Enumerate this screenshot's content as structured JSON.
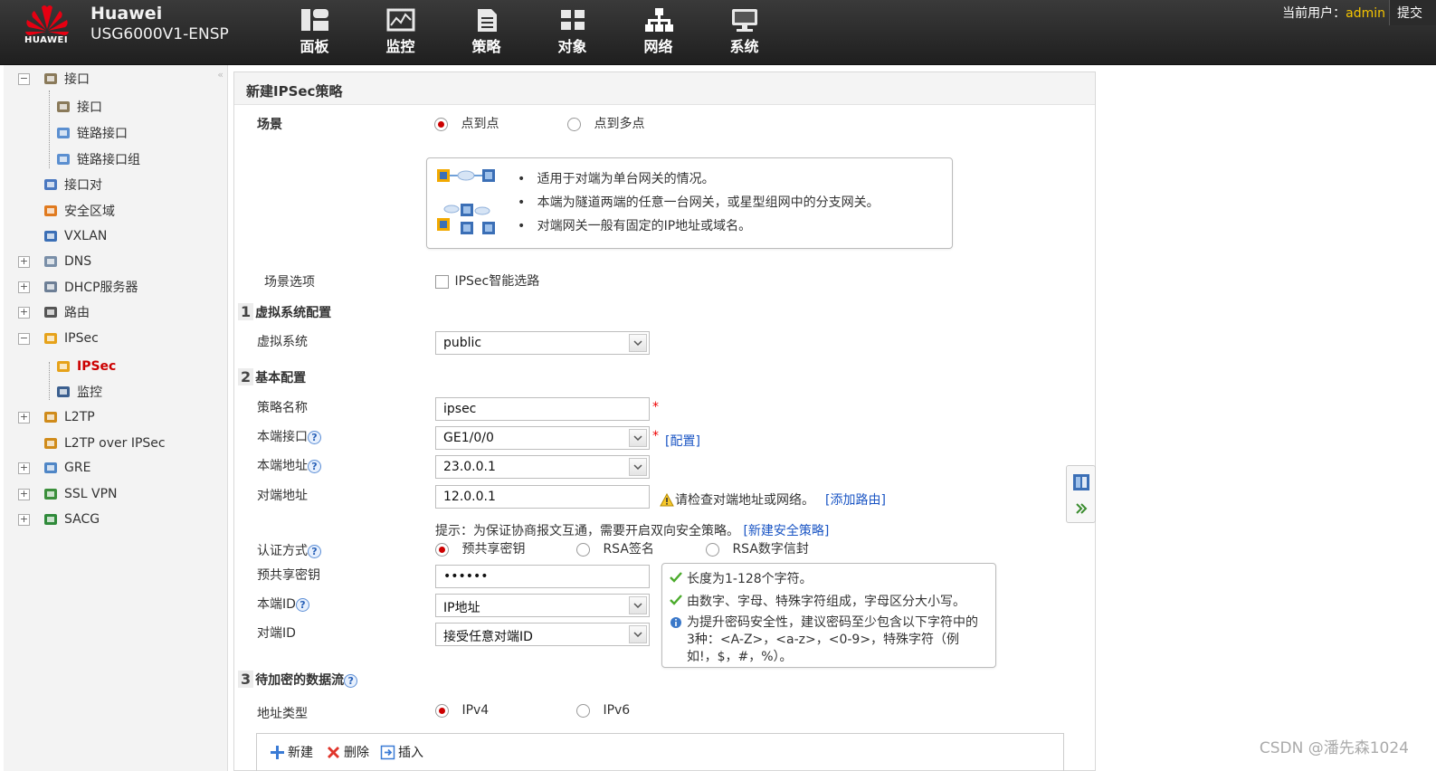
{
  "header": {
    "logo_text": "HUAWEI",
    "brand": "Huawei",
    "model": "USG6000V1-ENSP",
    "nav": [
      {
        "label": "面板",
        "icon": "dashboard-icon"
      },
      {
        "label": "监控",
        "icon": "monitor-icon"
      },
      {
        "label": "策略",
        "icon": "policy-icon"
      },
      {
        "label": "对象",
        "icon": "object-icon"
      },
      {
        "label": "网络",
        "icon": "network-icon"
      },
      {
        "label": "系统",
        "icon": "system-icon"
      }
    ],
    "user_label": "当前用户：",
    "user_name": "admin",
    "commit": "提交"
  },
  "sidebar": {
    "items": [
      {
        "label": "接口",
        "expander": "−",
        "icon": "interface-icon"
      },
      {
        "label": "接口",
        "icon": "interface-icon"
      },
      {
        "label": "链路接口",
        "icon": "link-interface-icon"
      },
      {
        "label": "链路接口组",
        "icon": "link-interface-group-icon"
      },
      {
        "label": "接口对",
        "icon": "interface-pair-icon"
      },
      {
        "label": "安全区域",
        "icon": "security-zone-icon"
      },
      {
        "label": "VXLAN",
        "icon": "vxlan-icon"
      },
      {
        "label": "DNS",
        "expander": "+",
        "icon": "dns-icon"
      },
      {
        "label": "DHCP服务器",
        "expander": "+",
        "icon": "dhcp-icon"
      },
      {
        "label": "路由",
        "expander": "+",
        "icon": "route-icon"
      },
      {
        "label": "IPSec",
        "expander": "−",
        "icon": "ipsec-icon"
      },
      {
        "label": "IPSec",
        "icon": "ipsec-icon",
        "active": true
      },
      {
        "label": "监控",
        "icon": "monitor-icon"
      },
      {
        "label": "L2TP",
        "expander": "+",
        "icon": "l2tp-icon"
      },
      {
        "label": "L2TP over IPSec",
        "icon": "l2tp-ipsec-icon"
      },
      {
        "label": "GRE",
        "expander": "+",
        "icon": "gre-icon"
      },
      {
        "label": "SSL VPN",
        "expander": "+",
        "icon": "ssl-vpn-icon"
      },
      {
        "label": "SACG",
        "expander": "+",
        "icon": "sacg-icon"
      }
    ]
  },
  "panel": {
    "title": "新建IPSec策略",
    "scene_label": "场景",
    "scene_options": [
      "点到点",
      "点到多点"
    ],
    "scene_selected": "点到点",
    "scene_info": [
      "适用于对端为单台网关的情况。",
      "本端为隧道两端的任意一台网关，或星型组网中的分支网关。",
      "对端网关一般有固定的IP地址或域名。"
    ],
    "scene_option_label": "场景选项",
    "smart_route_label": "IPSec智能选路",
    "section1": {
      "num": "1",
      "title": "虚拟系统配置"
    },
    "vsys_label": "虚拟系统",
    "vsys_value": "public",
    "section2": {
      "num": "2",
      "title": "基本配置"
    },
    "policy_name_label": "策略名称",
    "policy_name_value": "ipsec",
    "local_if_label": "本端接口",
    "local_if_value": "GE1/0/0",
    "config_link": "[配置]",
    "local_addr_label": "本端地址",
    "local_addr_value": "23.0.0.1",
    "peer_addr_label": "对端地址",
    "peer_addr_value": "12.0.0.1",
    "peer_warning": "请检查对端地址或网络。",
    "add_route_link": "[添加路由]",
    "hint_text": "提示：为保证协商报文互通，需要开启双向安全策略。",
    "new_policy_link": "[新建安全策略]",
    "auth_label": "认证方式",
    "auth_options": [
      "预共享密钥",
      "RSA签名",
      "RSA数字信封"
    ],
    "auth_selected": "预共享密钥",
    "psk_label": "预共享密钥",
    "psk_value": "••••••",
    "psk_tips": [
      {
        "icon": "check-icon",
        "text": "长度为1-128个字符。"
      },
      {
        "icon": "check-icon",
        "text": "由数字、字母、特殊字符组成，字母区分大小写。"
      },
      {
        "icon": "info-icon",
        "text": "为提升密码安全性，建议密码至少包含以下字符中的3种：<A-Z>，<a-z>，<0-9>，特殊字符（例如!，$，#，%）。"
      }
    ],
    "local_id_label": "本端ID",
    "local_id_value": "IP地址",
    "peer_id_label": "对端ID",
    "peer_id_value": "接受任意对端ID",
    "section3": {
      "num": "3",
      "title": "待加密的数据流"
    },
    "addr_type_label": "地址类型",
    "addr_type_options": [
      "IPv4",
      "IPv6"
    ],
    "addr_type_selected": "IPv4",
    "toolbar": {
      "new": "新建",
      "delete": "删除",
      "insert": "插入"
    }
  },
  "watermark": "CSDN @潘先森1024",
  "colors": {
    "accent_red": "#cc0000",
    "link_blue": "#1a55c4",
    "topbar": "#2a2a2a",
    "highlight": "#f5c400"
  }
}
